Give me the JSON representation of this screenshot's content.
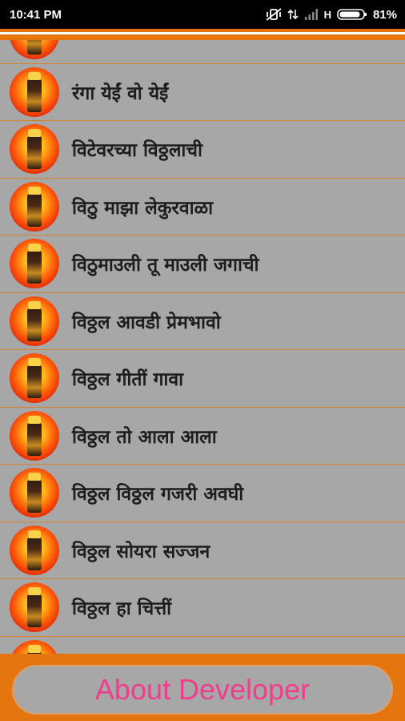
{
  "status_bar": {
    "time": "10:41 PM",
    "network": "H",
    "battery": "81%"
  },
  "list": {
    "items": [
      {
        "label": ""
      },
      {
        "label": "रंगा येईं वो येईं"
      },
      {
        "label": "विटेवरच्या विठ्ठलाची"
      },
      {
        "label": "विठु माझा लेकुरवाळा"
      },
      {
        "label": "विठुमाउली तू माउली जगाची"
      },
      {
        "label": "विठ्ठल आवडी प्रेमभावो"
      },
      {
        "label": "विठ्ठल गीतीं गावा"
      },
      {
        "label": "विठ्ठल तो आला आला"
      },
      {
        "label": "विठ्ठल विठ्ठल गजरी अवघी"
      },
      {
        "label": "विठ्ठल सोयरा सज्जन"
      },
      {
        "label": "विठ्ठल हा चित्तीं"
      },
      {
        "label": ""
      }
    ]
  },
  "footer": {
    "about_label": "About Developer"
  },
  "colors": {
    "accent": "#e4750f",
    "background": "#a8a7a7",
    "about_text": "#f03d8c"
  }
}
